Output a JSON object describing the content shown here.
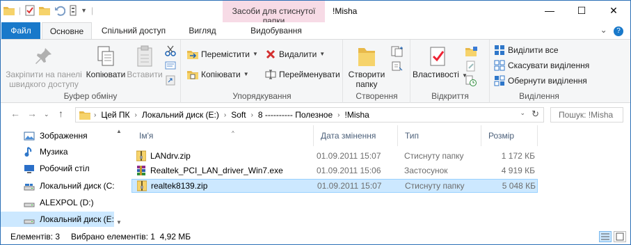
{
  "window": {
    "title": "!Misha",
    "context_tab_group": "Засоби для стиснутої папки",
    "controls": {
      "minimize": "—",
      "maximize": "☐",
      "close": "✕"
    }
  },
  "ribbon_tabs": {
    "file": "Файл",
    "home": "Основне",
    "share": "Спільний доступ",
    "view": "Вигляд",
    "extract": "Видобування"
  },
  "ribbon": {
    "clipboard": {
      "label": "Буфер обміну",
      "pin": "Закріпити на панелі швидкого доступу",
      "copy": "Копіювати",
      "paste": "Вставити"
    },
    "organize": {
      "label": "Упорядкування",
      "move_to": "Перемістити",
      "copy_to": "Копіювати",
      "delete": "Видалити",
      "rename": "Перейменувати"
    },
    "new": {
      "label": "Створення",
      "new_folder": "Створити папку"
    },
    "open": {
      "label": "Відкриття",
      "properties": "Властивості"
    },
    "select": {
      "label": "Виділення",
      "select_all": "Виділити все",
      "select_none": "Скасувати виділення",
      "invert": "Обернути виділення"
    }
  },
  "address": {
    "breadcrumbs": [
      "Цей ПК",
      "Локальний диск (E:)",
      "Soft",
      "8 ---------- Полезное",
      "!Misha"
    ],
    "search_placeholder": "Пошук: !Misha"
  },
  "nav_pane": {
    "items": [
      {
        "label": "Зображення",
        "icon": "pictures-icon"
      },
      {
        "label": "Музика",
        "icon": "music-icon"
      },
      {
        "label": "Робочий стіл",
        "icon": "desktop-icon"
      },
      {
        "label": "Локальний диск (C:)",
        "icon": "drive-icon"
      },
      {
        "label": "ALEXPOL (D:)",
        "icon": "drive-icon"
      },
      {
        "label": "Локальний диск (E:)",
        "icon": "drive-icon"
      }
    ]
  },
  "columns": {
    "name": "Ім'я",
    "date": "Дата змінення",
    "type": "Тип",
    "size": "Розмір"
  },
  "files": [
    {
      "name": "LANdrv.zip",
      "date": "01.09.2011 15:07",
      "type": "Стиснуту папку",
      "size": "1 172 КБ",
      "icon": "zip-folder-icon"
    },
    {
      "name": "Realtek_PCI_LAN_driver_Win7.exe",
      "date": "01.09.2011 15:06",
      "type": "Застосунок",
      "size": "4 919 КБ",
      "icon": "winrar-exe-icon"
    },
    {
      "name": "realtek8139.zip",
      "date": "01.09.2011 15:07",
      "type": "Стиснуту папку",
      "size": "5 048 КБ",
      "icon": "zip-folder-icon"
    }
  ],
  "status": {
    "items": "Елементів: 3",
    "selected": "Вибрано елементів: 1  4,92 МБ"
  },
  "colors": {
    "file_tab": "#1979ca",
    "context_tab": "#f7dbe6",
    "selection": "#cce8ff",
    "window_border": "#2b6fb6"
  }
}
